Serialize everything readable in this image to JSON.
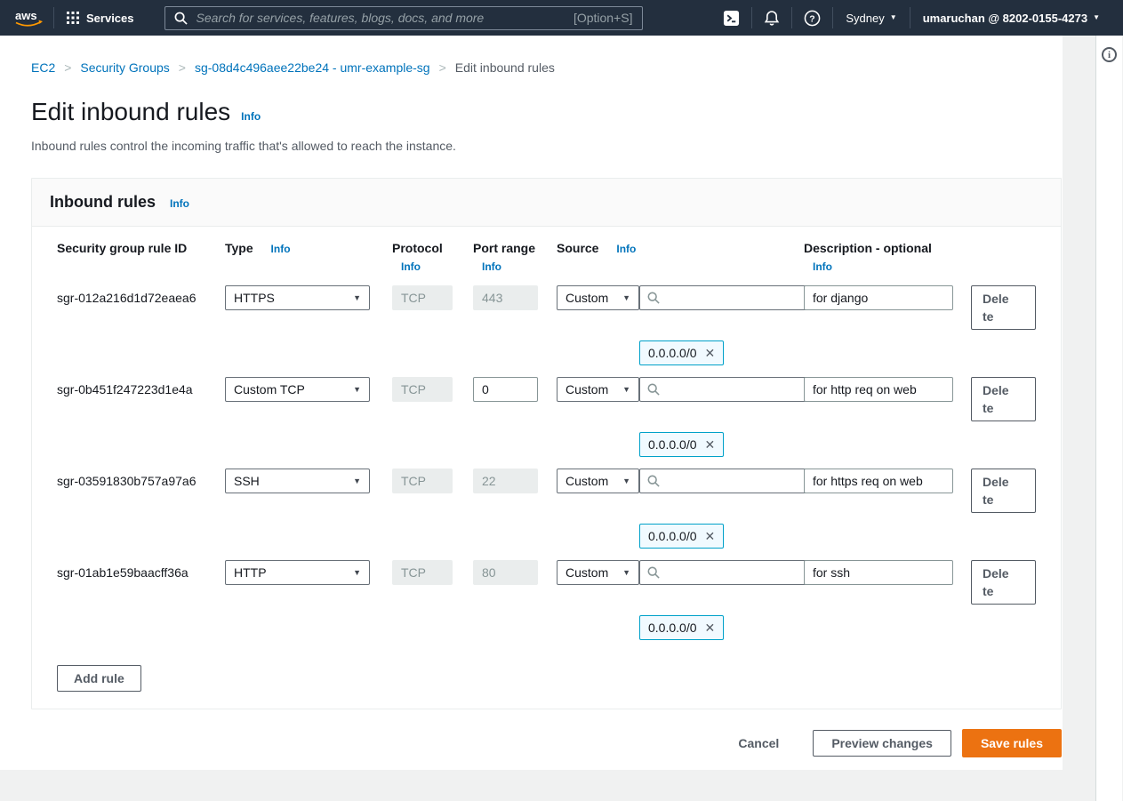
{
  "topnav": {
    "logo_text": "aws",
    "services_label": "Services",
    "search_placeholder": "Search for services, features, blogs, docs, and more",
    "search_shortcut": "[Option+S]",
    "region": "Sydney",
    "account": "umaruchan @ 8202-0155-4273"
  },
  "breadcrumb": {
    "items": [
      {
        "label": "EC2"
      },
      {
        "label": "Security Groups"
      },
      {
        "label": "sg-08d4c496aee22be24 - umr-example-sg"
      },
      {
        "label": "Edit inbound rules"
      }
    ]
  },
  "labels": {
    "info": "Info"
  },
  "page": {
    "title": "Edit inbound rules",
    "subtitle": "Inbound rules control the incoming traffic that's allowed to reach the instance."
  },
  "panel": {
    "title": "Inbound rules",
    "columns": {
      "id": "Security group rule ID",
      "type": "Type",
      "protocol": "Protocol",
      "port_range": "Port range",
      "source": "Source",
      "description": "Description - optional"
    },
    "rules": [
      {
        "id": "sgr-012a216d1d72eaea6",
        "type": "HTTPS",
        "protocol": "TCP",
        "port": "443",
        "source_mode": "Custom",
        "source_chip": "0.0.0.0/0",
        "description": "for django"
      },
      {
        "id": "sgr-0b451f247223d1e4a",
        "type": "Custom TCP",
        "protocol": "TCP",
        "port": "0",
        "source_mode": "Custom",
        "source_chip": "0.0.0.0/0",
        "description": "for http req on web"
      },
      {
        "id": "sgr-03591830b757a97a6",
        "type": "SSH",
        "protocol": "TCP",
        "port": "22",
        "source_mode": "Custom",
        "source_chip": "0.0.0.0/0",
        "description": "for https req on web"
      },
      {
        "id": "sgr-01ab1e59baacff36a",
        "type": "HTTP",
        "protocol": "TCP",
        "port": "80",
        "source_mode": "Custom",
        "source_chip": "0.0.0.0/0",
        "description": "for ssh"
      }
    ],
    "add_rule_label": "Add rule",
    "delete_label": "Delete"
  },
  "footer": {
    "cancel_label": "Cancel",
    "preview_label": "Preview changes",
    "save_label": "Save rules"
  },
  "icons": {
    "caret_down": "▼",
    "close": "✕",
    "breadcrumb_separator": ">",
    "help_panel_info": "i"
  },
  "colors": {
    "topnav_bg": "#232f3e",
    "logo_orange": "#ff9900",
    "accent_orange": "#ec7211",
    "link_blue": "#0073bb",
    "chip_border": "#00a1c9",
    "chip_bg": "#f1faff",
    "panel_border": "#eaeded",
    "page_bg": "#f0f1f1",
    "disabled_bg": "#eaeded",
    "disabled_text": "#879596",
    "muted_text": "#545b64"
  }
}
